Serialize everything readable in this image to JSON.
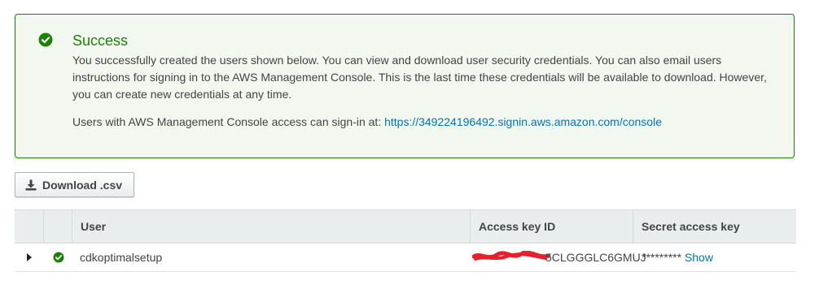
{
  "alert": {
    "title": "Success",
    "message": "You successfully created the users shown below. You can view and download user security credentials. You can also email users instructions for signing in to the AWS Management Console. This is the last time these credentials will be available to download. However, you can create new credentials at any time.",
    "signin_text": "Users with AWS Management Console access can sign-in at: ",
    "signin_url": "https://349224196492.signin.aws.amazon.com/console",
    "icon": "check-circle-icon",
    "color": "#1d8102"
  },
  "download_button": {
    "label": "Download .csv",
    "icon": "download-icon"
  },
  "table": {
    "columns": [
      "User",
      "Access key ID",
      "Secret access key"
    ],
    "rows": [
      {
        "user": "cdkoptimalsetup",
        "access_key_id_visible": "5CLGGGLC6GMUJ",
        "secret_mask": "*********",
        "show_label": "Show",
        "status_icon": "check-circle-icon"
      }
    ]
  },
  "colors": {
    "link": "#0073bb",
    "success": "#1d8102",
    "redaction": "#e8202a"
  }
}
